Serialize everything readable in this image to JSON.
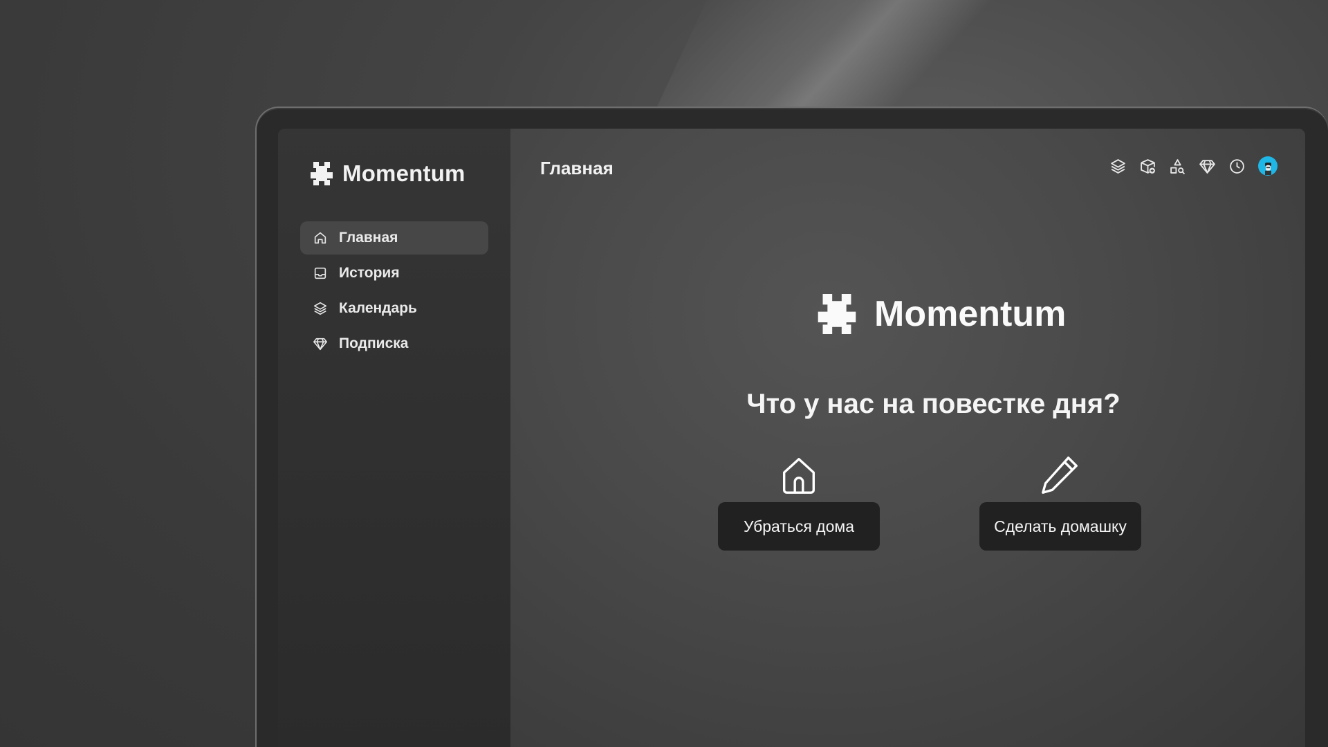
{
  "app": {
    "brand": "Momentum"
  },
  "sidebar": {
    "items": [
      {
        "label": "Главная",
        "icon": "home-icon",
        "active": true
      },
      {
        "label": "История",
        "icon": "inbox-icon",
        "active": false
      },
      {
        "label": "Календарь",
        "icon": "layers-icon",
        "active": false
      },
      {
        "label": "Подписка",
        "icon": "diamond-icon",
        "active": false
      }
    ]
  },
  "header": {
    "title": "Главная",
    "icons": [
      "layers-icon",
      "box-add-icon",
      "shapes-search-icon",
      "diamond-icon",
      "clock-icon",
      "avatar"
    ]
  },
  "main": {
    "brand": "Momentum",
    "question": "Что у нас на повестке дня?",
    "actions": [
      {
        "label": "Убраться дома",
        "icon": "house-icon"
      },
      {
        "label": "Сделать домашку",
        "icon": "pencil-icon"
      }
    ]
  },
  "colors": {
    "avatar_bg": "#1fb7e6",
    "button_bg": "#212121",
    "sidebar_active_bg": "#474747"
  }
}
